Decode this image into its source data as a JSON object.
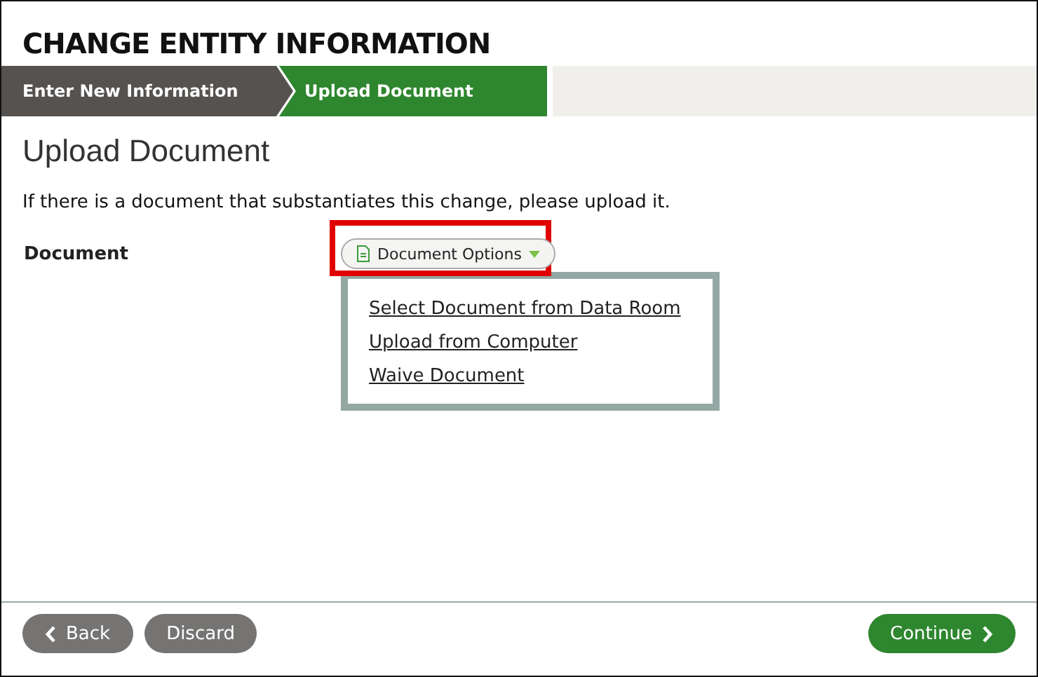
{
  "title": "CHANGE ENTITY INFORMATION",
  "steps": [
    {
      "label": "Enter New Information",
      "selected": false
    },
    {
      "label": "Upload Document",
      "selected": true
    }
  ],
  "heading": "Upload Document",
  "instruction": "If there is a document that substantiates this change, please upload it.",
  "field": {
    "label": "Document",
    "button": "Document Options",
    "highlighted": true
  },
  "menu": [
    "Select Document from Data Room",
    "Upload from Computer",
    "Waive Document"
  ],
  "buttons": [
    {
      "label": "Back",
      "kind": "back"
    },
    {
      "label": "Discard",
      "kind": "plain"
    },
    {
      "label": "Continue",
      "kind": "next"
    }
  ]
}
